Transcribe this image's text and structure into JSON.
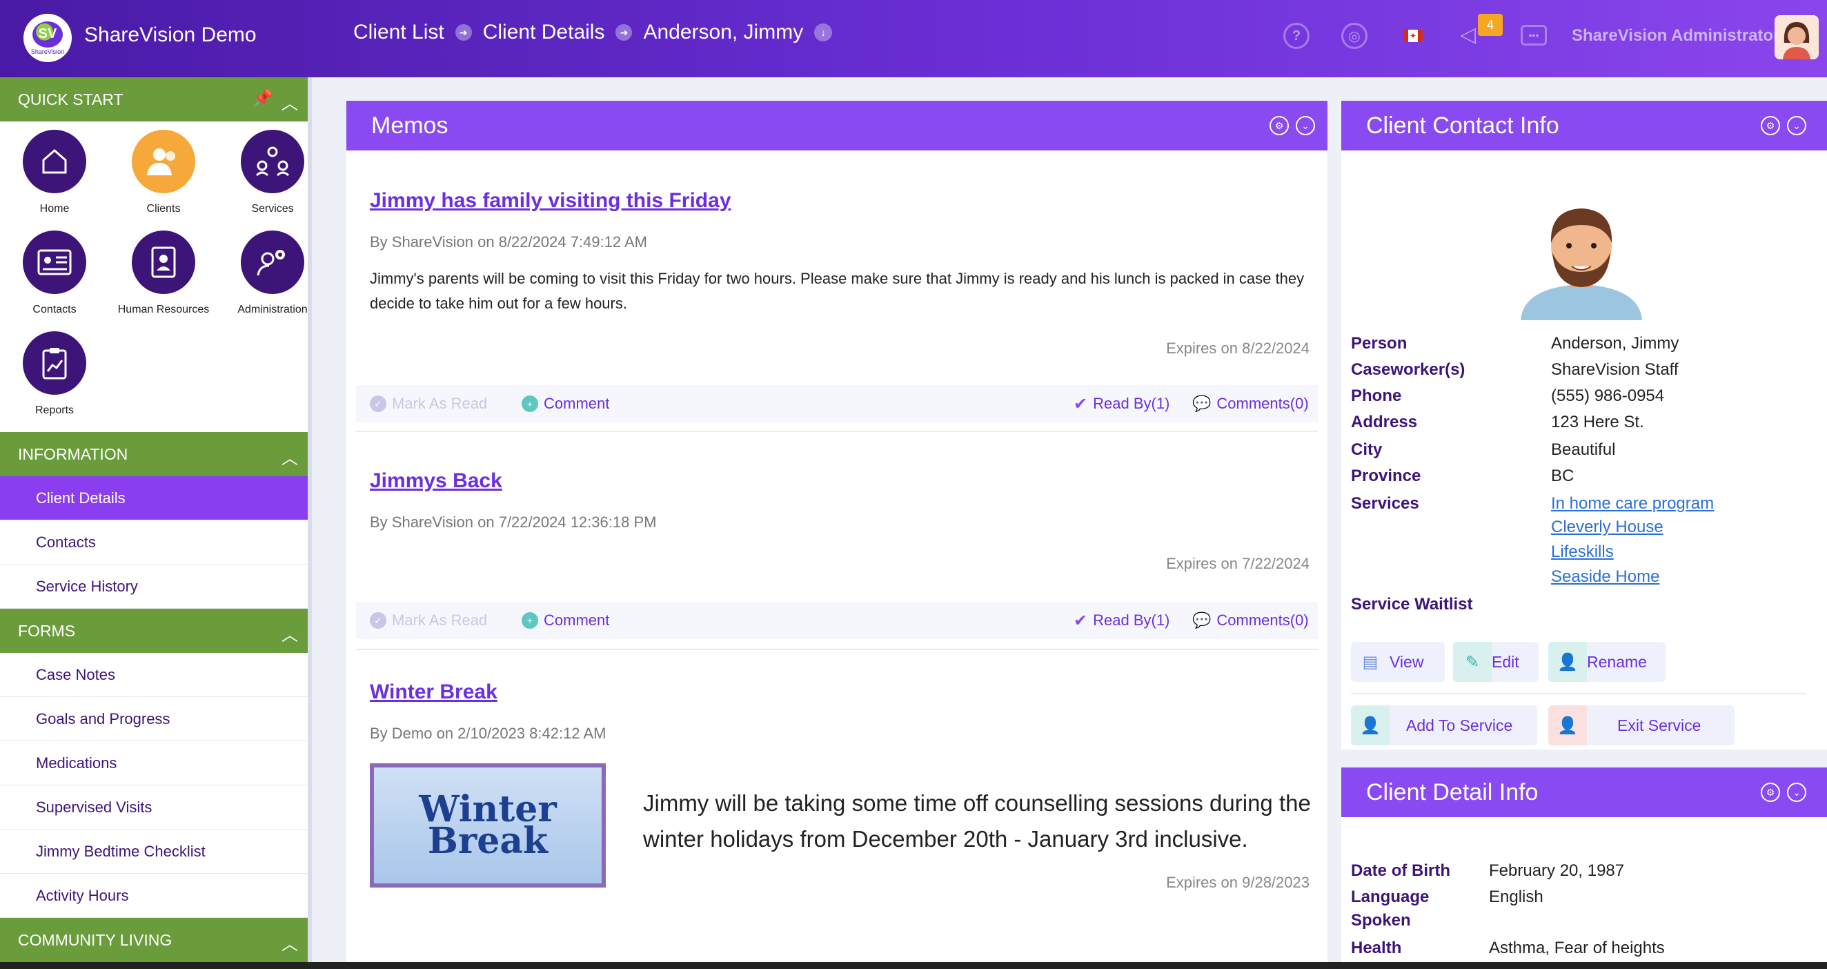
{
  "header": {
    "app_title": "ShareVision Demo",
    "logo_text": "SV",
    "logo_sub": "ShareVision",
    "breadcrumbs": [
      "Client List",
      "Client Details",
      "Anderson, Jimmy"
    ],
    "notification_count": "4",
    "user_name": "ShareVision Administrator"
  },
  "sidebar": {
    "quick_start_title": "QUICK START",
    "tiles": [
      {
        "label": "Home",
        "icon": "house-icon"
      },
      {
        "label": "Clients",
        "icon": "people-icon"
      },
      {
        "label": "Services",
        "icon": "network-icon"
      },
      {
        "label": "Contacts",
        "icon": "id-card-icon"
      },
      {
        "label": "Human Resources",
        "icon": "address-book-icon"
      },
      {
        "label": "Administration",
        "icon": "user-gear-icon"
      },
      {
        "label": "Reports",
        "icon": "clipboard-chart-icon"
      }
    ],
    "information_title": "INFORMATION",
    "information_items": [
      "Client Details",
      "Contacts",
      "Service History"
    ],
    "forms_title": "FORMS",
    "forms_items": [
      "Case Notes",
      "Goals and Progress",
      "Medications",
      "Supervised Visits",
      "Jimmy Bedtime Checklist",
      "Activity Hours"
    ],
    "community_title": "COMMUNITY LIVING"
  },
  "memos": {
    "title": "Memos",
    "actions": {
      "mark_read": "Mark As Read",
      "comment": "Comment"
    },
    "items": [
      {
        "title": "Jimmy has family visiting this Friday",
        "by": "By ShareVision on 8/22/2024 7:49:12 AM",
        "body": "Jimmy's parents will be coming to visit this Friday for two hours. Please make sure that Jimmy is ready and his lunch is packed in case they decide to take him out for a few hours.",
        "expires": "Expires on 8/22/2024",
        "read_by": "Read By(1)",
        "comments": "Comments(0)"
      },
      {
        "title": "Jimmys Back",
        "by": "By ShareVision on 7/22/2024 12:36:18 PM",
        "body": "",
        "expires": "Expires on 7/22/2024",
        "read_by": "Read By(1)",
        "comments": "Comments(0)"
      },
      {
        "title": "Winter Break",
        "by": "By Demo on 2/10/2023 8:42:12 AM",
        "image_text_1": "Winter",
        "image_text_2": "Break",
        "body": "Jimmy will be taking some time off counselling sessions during the winter holidays from December 20th - January 3rd inclusive.",
        "expires": "Expires on 9/28/2023"
      }
    ]
  },
  "contact": {
    "title": "Client Contact Info",
    "fields": [
      {
        "k": "Person",
        "v": "Anderson, Jimmy"
      },
      {
        "k": "Caseworker(s)",
        "v": "ShareVision Staff"
      },
      {
        "k": "Phone",
        "v": "(555) 986-0954"
      },
      {
        "k": "Address",
        "v": "123 Here St."
      },
      {
        "k": "City",
        "v": "Beautiful"
      },
      {
        "k": "Province",
        "v": "BC"
      }
    ],
    "services_label": "Services",
    "services": [
      "In home care program",
      "Cleverly House",
      "Lifeskills",
      "Seaside Home"
    ],
    "waitlist_label": "Service Waitlist",
    "buttons": {
      "view": "View",
      "edit": "Edit",
      "rename": "Rename",
      "add": "Add To Service",
      "exit": "Exit Service"
    }
  },
  "detail": {
    "title": "Client Detail Info",
    "dob_label": "Date of Birth",
    "dob": "February 20, 1987",
    "lang_label_1": "Language",
    "lang_label_2": "Spoken",
    "lang": "English",
    "health_label": "Health",
    "health": "Asthma, Fear of heights"
  }
}
